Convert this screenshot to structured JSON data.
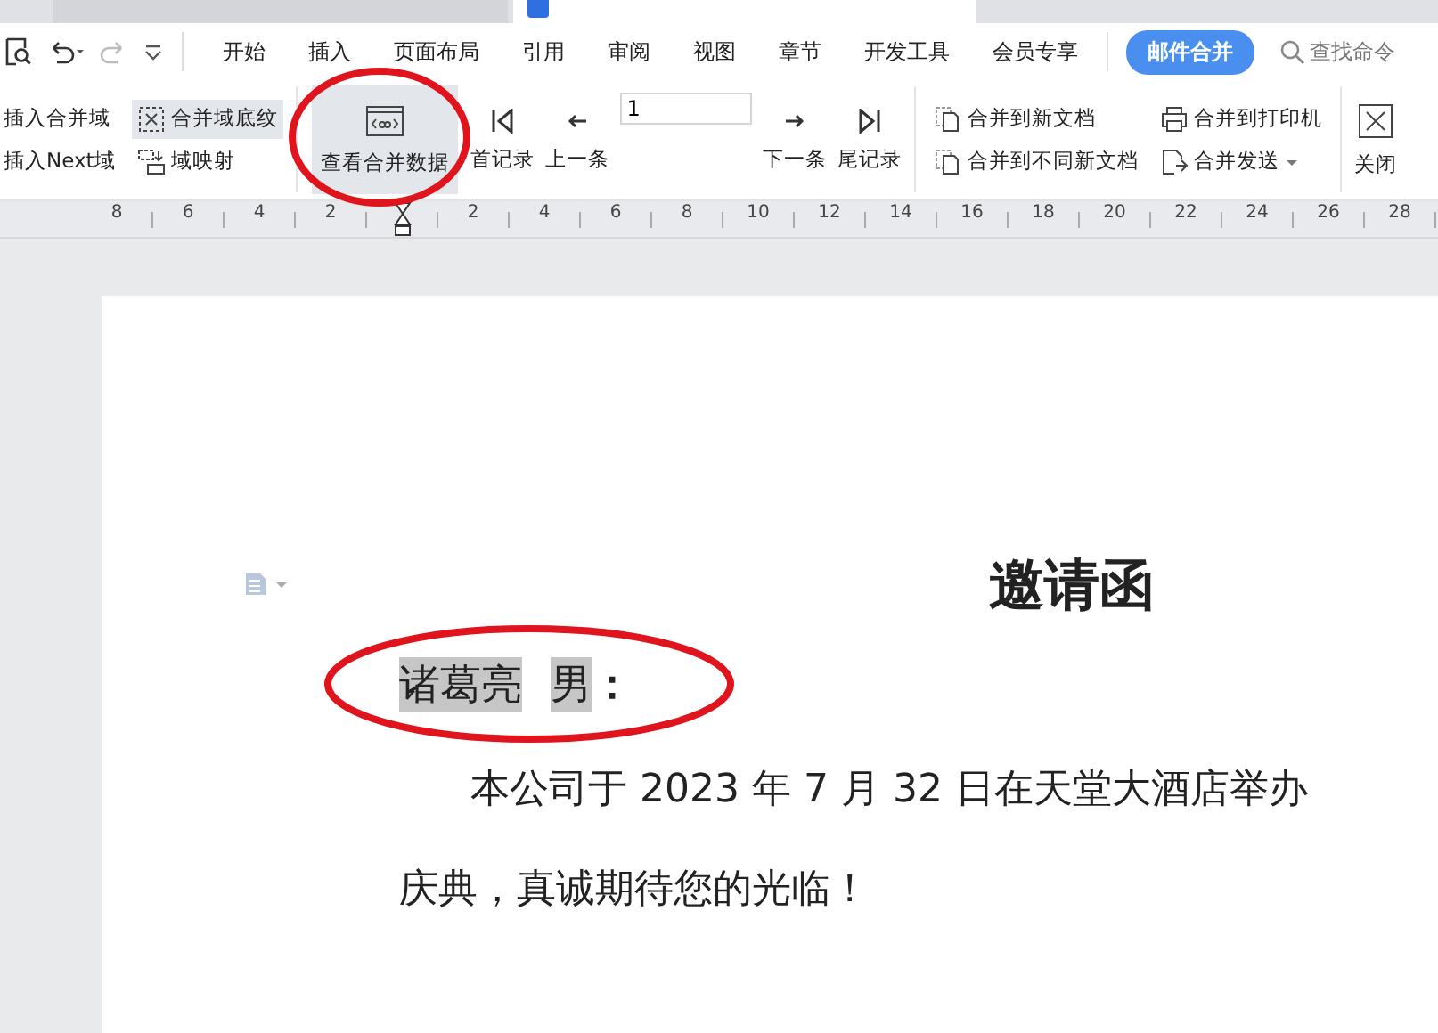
{
  "menu_tabs": [
    {
      "label": "开始",
      "selected": false
    },
    {
      "label": "插入",
      "selected": false
    },
    {
      "label": "页面布局",
      "selected": false
    },
    {
      "label": "引用",
      "selected": false
    },
    {
      "label": "审阅",
      "selected": false
    },
    {
      "label": "视图",
      "selected": false
    },
    {
      "label": "章节",
      "selected": false
    },
    {
      "label": "开发工具",
      "selected": false
    },
    {
      "label": "会员专享",
      "selected": false
    },
    {
      "label": "邮件合并",
      "selected": true
    }
  ],
  "search": {
    "placeholder": "查找命令"
  },
  "ribbon": {
    "insert_field": "插入合并域",
    "insert_next": "插入Next域",
    "field_shading": {
      "label": "合并域底纹",
      "on": true
    },
    "field_map": "域映射",
    "view_data": {
      "label": "查看合并数据",
      "on": true
    },
    "first": "首记录",
    "prev": "上一条",
    "record": "1",
    "next": "下一条",
    "last": "尾记录",
    "to_new": "合并到新文档",
    "to_diff": "合并到不同新文档",
    "to_printer": "合并到打印机",
    "send": "合并发送",
    "close": "关闭"
  },
  "ruler": {
    "left_labels": [
      "8",
      "6",
      "4",
      "2"
    ],
    "right_labels": [
      "2",
      "4",
      "6",
      "8",
      "10",
      "12",
      "14",
      "16",
      "18",
      "20",
      "22",
      "24",
      "26",
      "28"
    ]
  },
  "document": {
    "title": "邀请函",
    "greeting": [
      {
        "text": "诸葛亮",
        "kind": "field"
      },
      {
        "text": "男",
        "kind": "field"
      },
      {
        "text": "：",
        "kind": "plain"
      }
    ],
    "paragraph_lines": [
      "本公司于 2023 年 7 月 32 日在天堂大酒店举办",
      "庆典，真诚期待您的光临！"
    ]
  }
}
